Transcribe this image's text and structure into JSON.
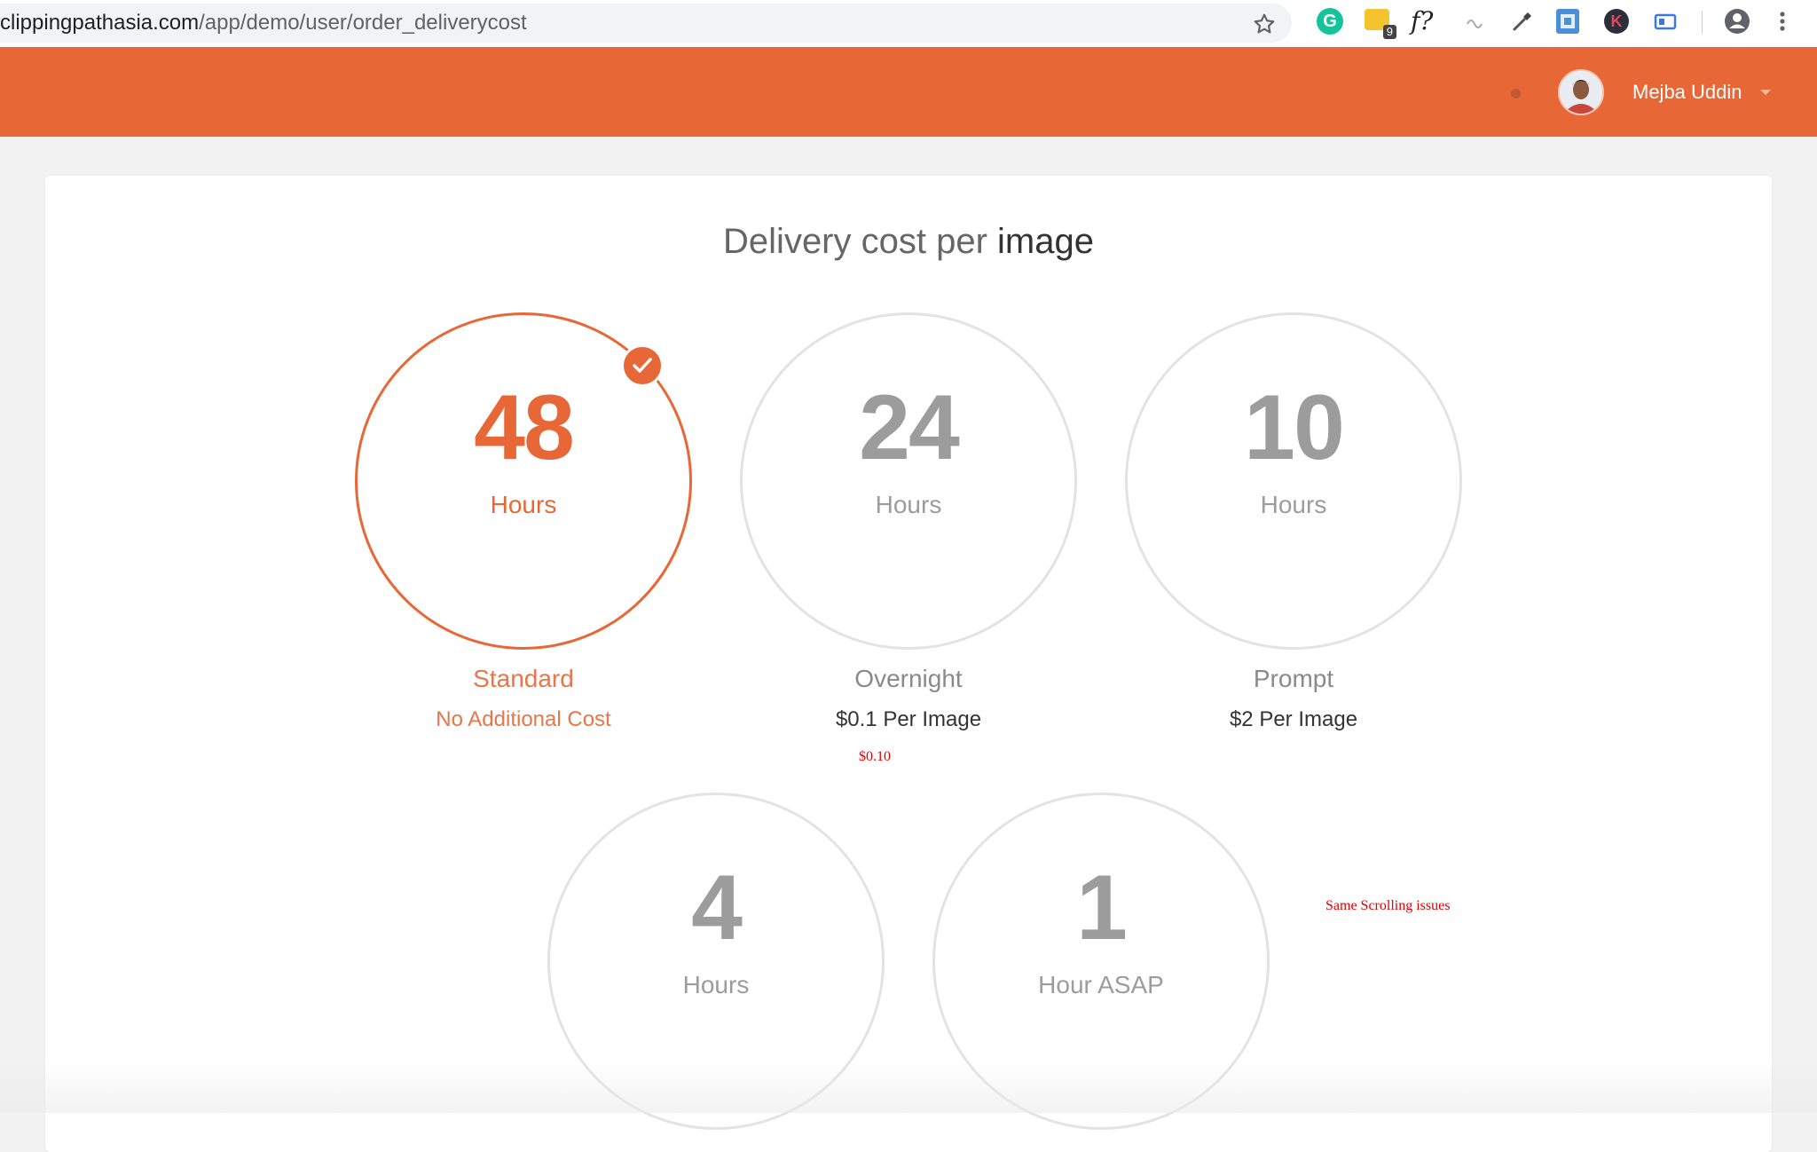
{
  "browser": {
    "url_host": "clippingpathasia.com",
    "url_path": "/app/demo/user/order_deliverycost",
    "extensions": [
      "grammarly-icon",
      "notes-extension-icon",
      "font-identifier-icon",
      "wave-extension-icon",
      "color-dropper-icon",
      "card-extension-icon",
      "k-extension-icon",
      "cast-extension-icon"
    ],
    "grammarly_letter": "G",
    "notes_badge": "9",
    "font_ext_label": "f?",
    "k_letter": "K"
  },
  "header": {
    "user_name": "Mejba Uddin",
    "accent_color": "#e86736"
  },
  "page": {
    "title_light": "Delivery cost per ",
    "title_strong": "image"
  },
  "options": [
    {
      "number": "48",
      "unit": "Hours",
      "label": "Standard",
      "price": "No Additional Cost",
      "selected": true
    },
    {
      "number": "24",
      "unit": "Hours",
      "label": "Overnight",
      "price": "$0.1 Per Image",
      "selected": false
    },
    {
      "number": "10",
      "unit": "Hours",
      "label": "Prompt",
      "price": "$2 Per Image",
      "selected": false
    },
    {
      "number": "4",
      "unit": "Hours",
      "label": "",
      "price": "",
      "selected": false
    },
    {
      "number": "1",
      "unit": "Hour ASAP",
      "label": "",
      "price": "",
      "selected": false
    }
  ],
  "annotations": {
    "price_note": "$0.10",
    "scroll_note": "Same Scrolling issues",
    "color": "#e00000"
  }
}
